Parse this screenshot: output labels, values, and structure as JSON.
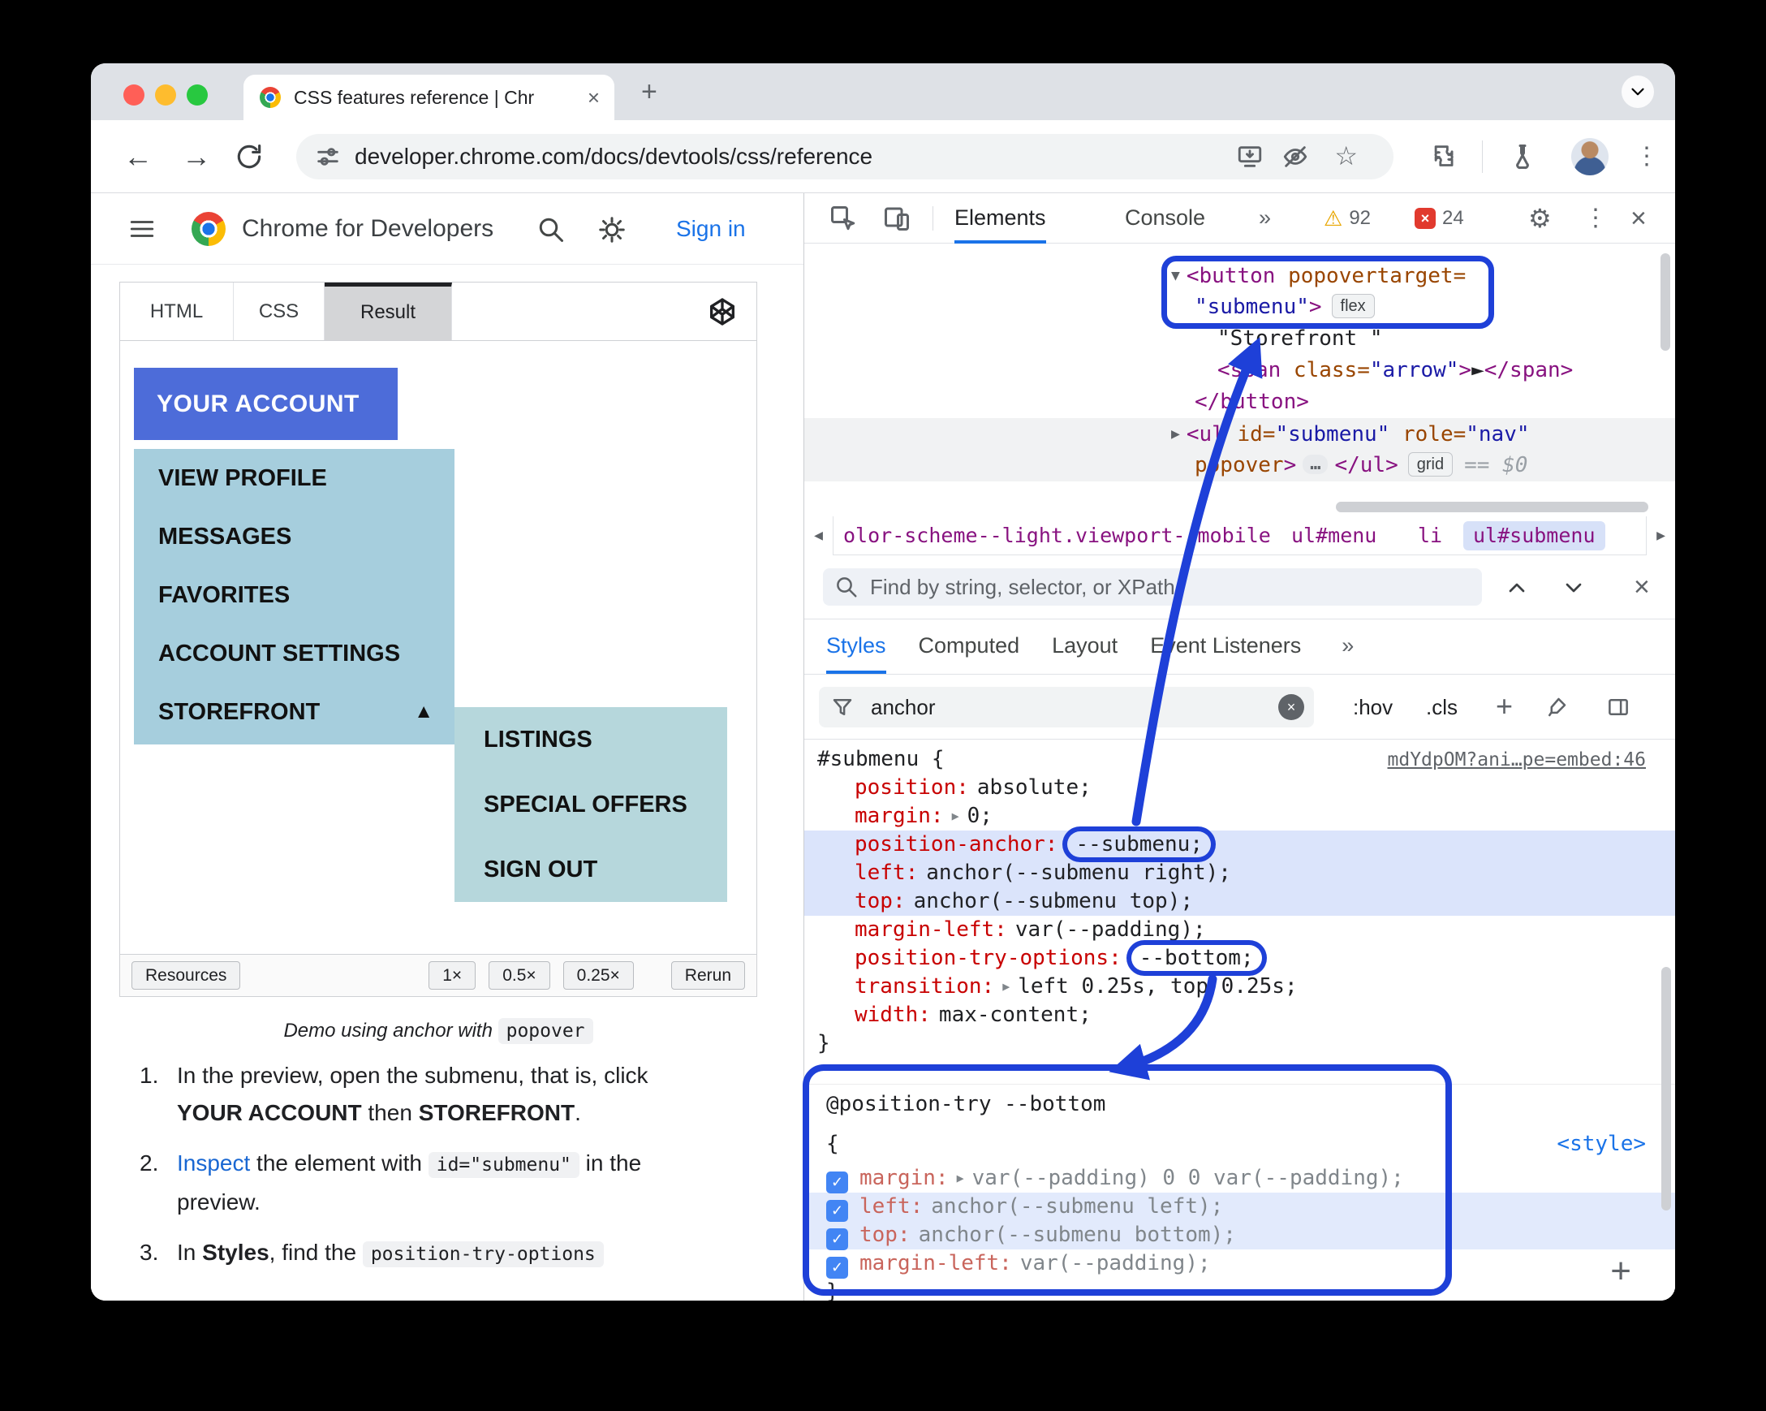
{
  "colors": {
    "annot": "#1e40d8",
    "accent": "#1a73e8",
    "link": "#1967d2",
    "prop": "#c80000",
    "tag": "#881280",
    "attr": "#994500",
    "attrval": "#1a1aa6",
    "muted": "#5f6368",
    "hl": "#dbe4fb",
    "btn_blue": "#4d6cd9",
    "menu_bg": "#a6cedd",
    "submenu_bg": "#b6d7dc"
  },
  "icons": {
    "back": "←",
    "forward": "→",
    "new_tab": "+",
    "close": "×",
    "kebab": "⋮",
    "gear": "⚙",
    "warning": "⚠",
    "star": "☆",
    "expanded": "▼",
    "collapsed": "▶",
    "menu_up": "▲",
    "crumb_left": "◀",
    "crumb_right": "▶",
    "plus": "+",
    "check": "✓",
    "inline_expand": "▶"
  },
  "browser": {
    "tab_title": "CSS features reference  |  Chr",
    "url": "developer.chrome.com/docs/devtools/css/reference"
  },
  "page": {
    "brand": "Chrome for Developers",
    "sign_in": "Sign in",
    "code_tabs": [
      "HTML",
      "CSS",
      "Result"
    ],
    "demo": {
      "account": "YOUR ACCOUNT",
      "menu": [
        "VIEW PROFILE",
        "MESSAGES",
        "FAVORITES",
        "ACCOUNT SETTINGS",
        "STOREFRONT"
      ],
      "submenu": [
        "LISTINGS",
        "SPECIAL OFFERS",
        "SIGN OUT"
      ],
      "resources": "Resources",
      "scales": [
        "1×",
        "0.5×",
        "0.25×"
      ],
      "rerun": "Rerun"
    },
    "caption": {
      "text": "Demo using anchor with",
      "code": "popover"
    },
    "steps": {
      "n1": "1.",
      "s1a": "In the preview, open the submenu, that is, click ",
      "s1b": "YOUR ACCOUNT",
      "s1c": " then ",
      "s1d": "STOREFRONT",
      "s1e": ".",
      "n2": "2.",
      "s2a": "Inspect",
      "s2b": " the element with ",
      "s2c": "id=\"submenu\"",
      "s2d": " in the preview.",
      "n3": "3.",
      "s3a": "In ",
      "s3b": "Styles",
      "s3c": ", find the ",
      "s3d": "position-try-options"
    }
  },
  "devtools": {
    "tabs": {
      "elements": "Elements",
      "console": "Console",
      "more": "»"
    },
    "counts": {
      "warnings": "92",
      "errors": "24"
    },
    "dom": {
      "t_btn_open": "<button ",
      "t_btn_attr": "popovertarget=",
      "t_btn_val": "\"submenu\"",
      "t_gt": ">",
      "badge_flex": "flex",
      "t_text": "\"Storefront \"",
      "t_span_open": "<span ",
      "t_span_attr": "class=",
      "t_span_val": "\"arrow\"",
      "t_arrow_glyph": "►",
      "t_span_close": "</span>",
      "t_btn_close": "</button>",
      "t_ul_open": "<ul ",
      "t_id": "id=",
      "t_id_val": "\"submenu\"",
      "t_role": " role=",
      "t_role_val": "\"nav\"",
      "t_popover": "popover",
      "ellipsis": "…",
      "t_ul_close": "</ul>",
      "badge_grid": "grid",
      "eq": "== $0"
    },
    "crumbs": [
      "olor-scheme--light.viewport--mobile",
      "ul#menu",
      "li",
      "ul#submenu"
    ],
    "find_placeholder": "Find by string, selector, or XPath",
    "style_tabs": [
      "Styles",
      "Computed",
      "Layout",
      "Event Listeners"
    ],
    "filter": {
      "text": "anchor",
      "hov": ":hov",
      "cls": ".cls"
    },
    "rule": {
      "selector": "#submenu {",
      "source": "mdYdpOM?ani…pe=embed:46",
      "close": "}",
      "props": [
        {
          "name": "position:",
          "value": "absolute;"
        },
        {
          "name": "margin:",
          "value": "0;",
          "expand": true
        },
        {
          "name": "position-anchor:",
          "value": "--submenu;",
          "ring": true,
          "highlight": true
        },
        {
          "name": "left:",
          "value": "anchor(--submenu right);",
          "highlight": true
        },
        {
          "name": "top:",
          "value": "anchor(--submenu top);",
          "highlight": true
        },
        {
          "name": "margin-left:",
          "value": "var(--padding);"
        },
        {
          "name": "position-try-options:",
          "value": "--bottom;",
          "ring": true
        },
        {
          "name": "transition:",
          "value": "left 0.25s, top 0.25s;",
          "expand": true
        },
        {
          "name": "width:",
          "value": "max-content;"
        }
      ]
    },
    "position_try": {
      "header": "@position-try --bottom",
      "open": "{",
      "close": "}",
      "style_link": "<style>",
      "props": [
        {
          "name": "margin:",
          "value": "var(--padding) 0 0 var(--padding);",
          "expand": true,
          "checked": true
        },
        {
          "name": "left:",
          "value": "anchor(--submenu left);",
          "checked": true,
          "highlight": true
        },
        {
          "name": "top:",
          "value": "anchor(--submenu bottom);",
          "checked": true,
          "highlight": true
        },
        {
          "name": "margin-left:",
          "value": "var(--padding);",
          "checked": true
        }
      ]
    }
  }
}
